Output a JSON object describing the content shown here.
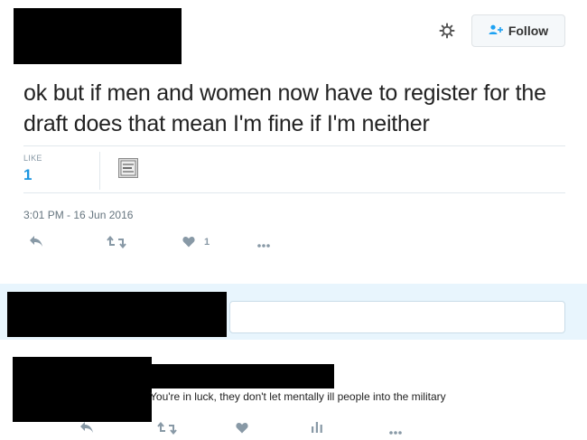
{
  "header": {
    "follow_label": "Follow",
    "gear_icon": "gear-icon",
    "follow_icon": "add-person-icon"
  },
  "tweet": {
    "text": "ok but if men and women now have to register for the draft does that mean I'm fine if I'm neither",
    "like_label": "LIKE",
    "like_count": "1",
    "timestamp": "3:01 PM - 16 Jun 2016",
    "actions": {
      "reply_icon": "reply-icon",
      "retweet_icon": "retweet-icon",
      "like_icon": "heart-icon",
      "like_count": "1",
      "more_icon": "more-icon"
    }
  },
  "reply": {
    "text": "You're in luck, they don't let mentally ill people into the military",
    "actions": {
      "reply_icon": "reply-icon",
      "retweet_icon": "retweet-icon",
      "like_icon": "heart-icon",
      "analytics_icon": "analytics-icon",
      "more_icon": "more-icon"
    }
  },
  "colors": {
    "accent": "#1da1f2",
    "like_count": "#1b95e0",
    "compose_band": "#e8f5fd",
    "muted": "#8899a6"
  }
}
